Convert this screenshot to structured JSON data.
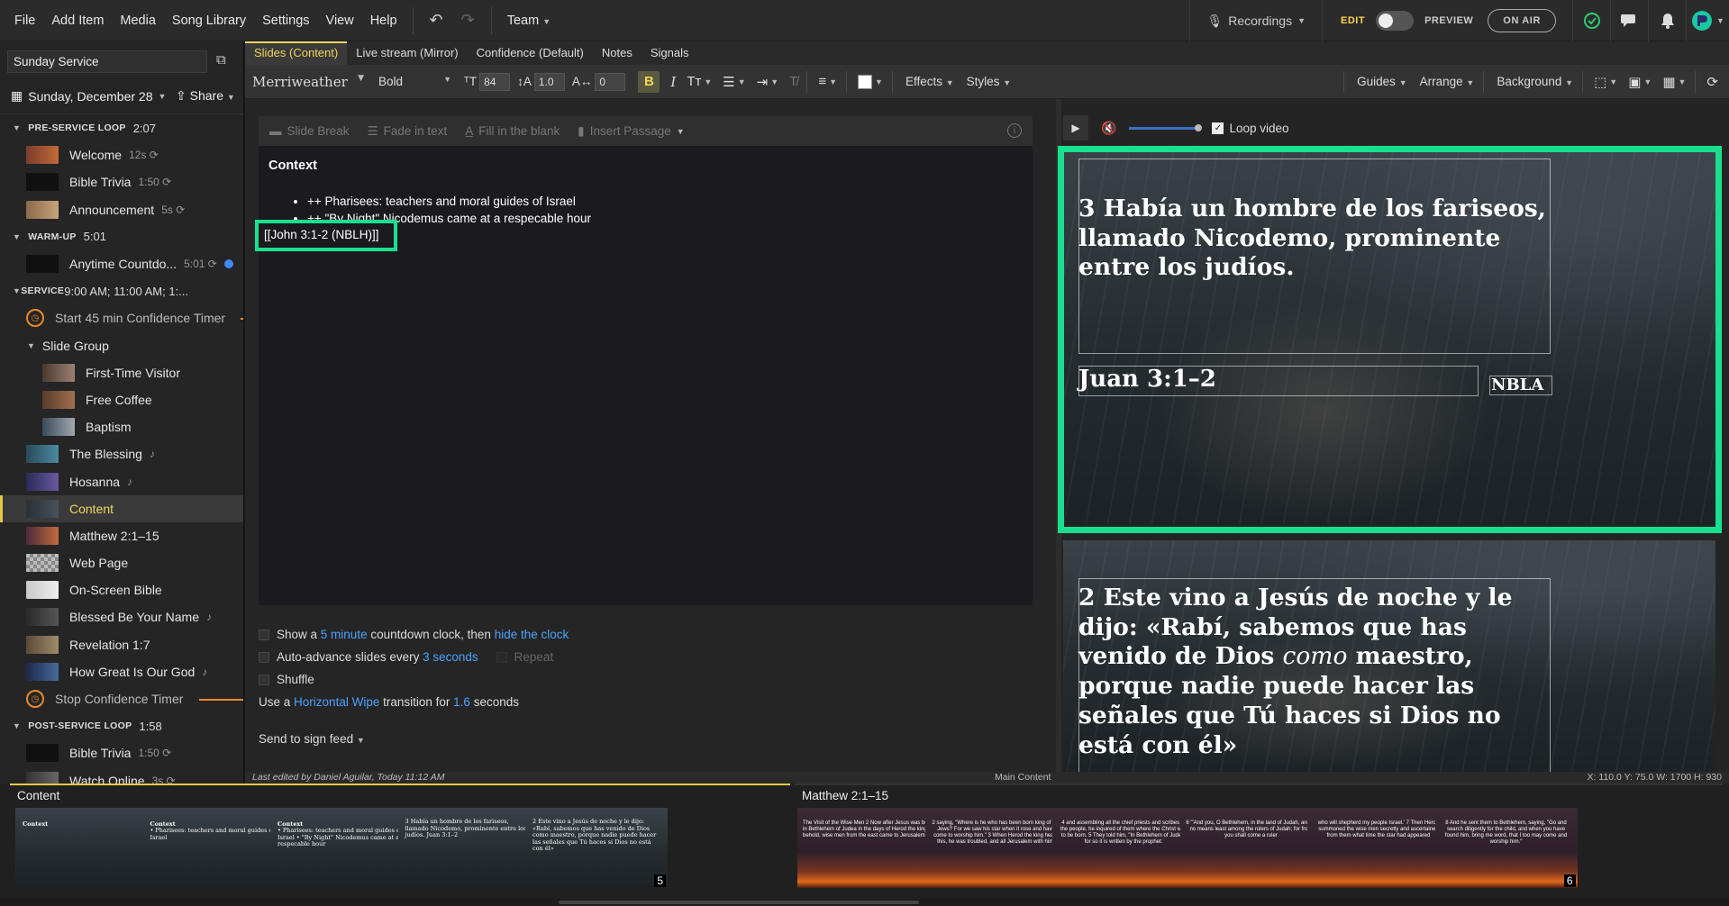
{
  "menu": [
    "File",
    "Add Item",
    "Media",
    "Song Library",
    "Settings",
    "View",
    "Help"
  ],
  "team_label": "Team",
  "header": {
    "recordings": "Recordings",
    "edit": "EDIT",
    "preview": "PREVIEW",
    "on_air": "ON AIR"
  },
  "sidebar": {
    "service_name": "Sunday Service",
    "date": "Sunday, December 28",
    "share": "Share",
    "rows": [
      {
        "kind": "section",
        "label": "PRE-SERVICE LOOP",
        "time": "2:07"
      },
      {
        "kind": "item",
        "label": "Welcome",
        "meta": "12s ⟳",
        "thumb": "linear-gradient(90deg,#7a3d2a,#c26a3a)"
      },
      {
        "kind": "item",
        "label": "Bible Trivia",
        "meta": "1:50 ⟳",
        "thumb": "#111"
      },
      {
        "kind": "item",
        "label": "Announcement",
        "meta": "5s ⟳",
        "thumb": "linear-gradient(90deg,#8a6a4a,#c9a37a)"
      },
      {
        "kind": "section",
        "label": "WARM-UP",
        "time": "5:01"
      },
      {
        "kind": "item",
        "label": "Anytime Countdo...",
        "meta": "5:01 ⟳",
        "thumb": "#111"
      },
      {
        "kind": "section",
        "label": "SERVICE",
        "time": "9:00 AM; 11:00 AM; 1:..."
      },
      {
        "kind": "timer",
        "label": "Start 45 min Confidence Timer"
      },
      {
        "kind": "group",
        "label": "Slide Group"
      },
      {
        "kind": "sub",
        "label": "First-Time Visitor",
        "thumb": "linear-gradient(90deg,#4a3a30,#9a8070)"
      },
      {
        "kind": "sub",
        "label": "Free Coffee",
        "thumb": "linear-gradient(90deg,#5a3a2a,#a07050)"
      },
      {
        "kind": "sub",
        "label": "Baptism",
        "thumb": "linear-gradient(90deg,#3a4a5a,#a0a8b0)"
      },
      {
        "kind": "item",
        "label": "The Blessing",
        "meta": "♪",
        "thumb": "linear-gradient(90deg,#2a4a5a,#4a8aa0)"
      },
      {
        "kind": "item",
        "label": "Hosanna",
        "meta": "♪",
        "thumb": "linear-gradient(90deg,#2a2a5a,#6a5aa0)"
      },
      {
        "kind": "item",
        "label": "Content",
        "meta": "",
        "thumb": "linear-gradient(90deg,#2a3036,#48525a)",
        "active": true
      },
      {
        "kind": "item",
        "label": "Matthew 2:1–15",
        "meta": "",
        "thumb": "linear-gradient(90deg,#4a2a3a,#c26a3a)"
      },
      {
        "kind": "item",
        "label": "Web Page",
        "meta": "",
        "thumb": "repeating-conic-gradient(#888 0 25%, #bbb 0 50%) 0 0/8px 8px"
      },
      {
        "kind": "item",
        "label": "On-Screen Bible",
        "meta": "",
        "thumb": "linear-gradient(90deg,#c8c8c8,#eee)"
      },
      {
        "kind": "item",
        "label": "Blessed Be Your Name",
        "meta": "♪",
        "thumb": "linear-gradient(90deg,#2a2a2a,#555)"
      },
      {
        "kind": "item",
        "label": "Revelation 1:7",
        "meta": "",
        "thumb": "linear-gradient(90deg,#5a4a3a,#a08a6a)"
      },
      {
        "kind": "item",
        "label": "How Great Is Our God",
        "meta": "♪",
        "thumb": "linear-gradient(90deg,#1a2a4a,#4a6a9a)"
      },
      {
        "kind": "timer",
        "label": "Stop Confidence Timer"
      },
      {
        "kind": "section",
        "label": "POST-SERVICE LOOP",
        "time": "1:58"
      },
      {
        "kind": "item",
        "label": "Bible Trivia",
        "meta": "1:50 ⟳",
        "thumb": "#111"
      },
      {
        "kind": "item",
        "label": "Watch Online",
        "meta": "3s ⟳",
        "thumb": "linear-gradient(90deg,#333,#666)"
      }
    ]
  },
  "tabs": [
    "Slides (Content)",
    "Live stream (Mirror)",
    "Confidence (Default)",
    "Notes",
    "Signals"
  ],
  "toolbar": {
    "font": "Merriweather",
    "weight": "Bold",
    "size": "84",
    "line_height": "1.0",
    "spacing": "0",
    "effects": "Effects",
    "styles": "Styles",
    "guides": "Guides",
    "arrange": "Arrange",
    "background": "Background"
  },
  "editor": {
    "bar": [
      "Slide Break",
      "Fade in text",
      "Fill in the blank",
      "Insert Passage"
    ],
    "heading": "Context",
    "bullets": [
      "++ Pharisees: teachers and moral guides of Israel",
      "++ \"By Night\" Nicodemus came at a respecable hour"
    ],
    "reference": "[[John 3:1-2 (NBLH)]]"
  },
  "options": {
    "show_a": "Show a",
    "countdown_link": "5 minute",
    "countdown_mid": "countdown clock, then",
    "hide_link": "hide the clock",
    "advance_pre": "Auto-advance slides every",
    "advance_link": "3 seconds",
    "repeat": "Repeat",
    "shuffle": "Shuffle",
    "use_a": "Use a",
    "transition_link": "Horizontal Wipe",
    "transition_mid": "transition for",
    "duration_link": "1.6",
    "seconds": "seconds",
    "send_feed": "Send to sign feed"
  },
  "preview": {
    "loop_label": "Loop video",
    "slide1_text": "3 Había un hombre de los fariseos, llamado Nicodemo, prominente entre los judíos.",
    "slide1_ref": "Juan 3:1–2",
    "slide1_version": "NBLA",
    "slide2_lead": "2 Este vino a Jesús de noche y le dijo: «Rabí, sabemos que has venido de Dios",
    "slide2_em": "como",
    "slide2_tail": "maestro, porque nadie puede hacer las señales que Tú haces si Dios no está con él»"
  },
  "status": {
    "edited": "Last edited by Daniel Aguilar, Today 11:12 AM",
    "main_content": "Main Content",
    "coords": "X: 110.0  Y: 75.0    W: 1700  H: 930"
  },
  "filmstrip": {
    "content_title": "Content",
    "content_slides": [
      {
        "title": "Context",
        "body": "",
        "num": "1"
      },
      {
        "title": "Context",
        "body": "• Pharisees: teachers and moral guides of Israel",
        "num": "2"
      },
      {
        "title": "Context",
        "body": "• Pharisees: teachers and moral guides of Israel • \"By Night\" Nicodemus came at a respecable hour",
        "num": "3"
      },
      {
        "title": "",
        "body": "3 Había un hombre de los fariseos, llamado Nicodemo, prominente entre los judíos.   Juan 3:1–2",
        "num": "4"
      },
      {
        "title": "",
        "body": "2 Este vino a Jesús de noche y le dijo: «Rabí, sabemos que has venido de Dios como maestro, porque nadie puede hacer las señales que Tú haces si Dios no está con él»",
        "num": "5"
      }
    ],
    "matthew_title": "Matthew 2:1–15",
    "matthew_slides": [
      {
        "body": "The Visit of the Wise Men  2 Now after Jesus was born in Bethlehem of Judea in the days of Herod the king, behold, wise men from the east came to Jerusalem",
        "num": "1"
      },
      {
        "body": "2 saying, \"Where is he who has been born king of the Jews? For we saw his star when it rose and have come to worship him.\" 3 When Herod the king heard this, he was troubled, and all Jerusalem with him;",
        "num": "2"
      },
      {
        "body": "4 and assembling all the chief priests and scribes of the people, he inquired of them where the Christ was to be born. 5 They told him, \"In Bethlehem of Judea, for so it is written by the prophet:",
        "num": "3"
      },
      {
        "body": "6 \"'And you, O Bethlehem, in the land of Judah, are by no means least among the rulers of Judah; for from you shall come a ruler",
        "num": "4"
      },
      {
        "body": "who will shepherd my people Israel.' 7 Then Herod summoned the wise men secretly and ascertained from them what time the star had appeared",
        "num": "5"
      },
      {
        "body": "8 And he sent them to Bethlehem, saying, \"Go and search diligently for the child, and when you have found him, bring me word, that I too may come and worship him.\"",
        "num": "6"
      }
    ]
  }
}
